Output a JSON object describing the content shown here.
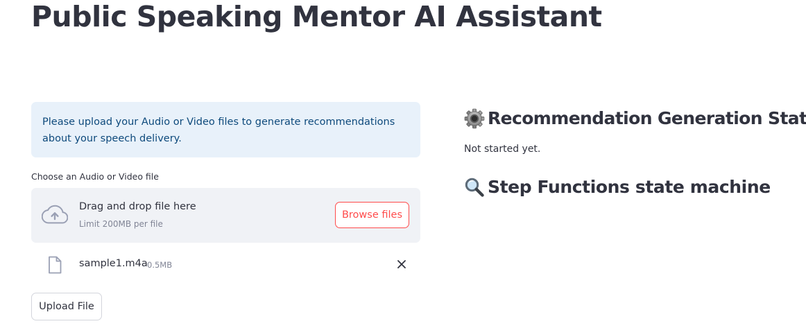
{
  "page": {
    "title": "Public Speaking Mentor AI Assistant"
  },
  "info": {
    "message": "Please upload your Audio or Video files to generate recommendations about your speech delivery."
  },
  "uploader": {
    "label": "Choose an Audio or Video file",
    "drop_text": "Drag and drop file here",
    "limit_text": "Limit 200MB per file",
    "browse_label": "Browse files",
    "upload_icon": "cloud-upload-icon"
  },
  "file": {
    "name": "sample1.m4a",
    "size": "0.5MB",
    "icon": "file-icon"
  },
  "actions": {
    "upload_label": "Upload File"
  },
  "status": {
    "title": "Recommendation Generation Status",
    "icon": "gear-icon",
    "text": "Not started yet."
  },
  "state_machine": {
    "title": "Step Functions state machine",
    "icon": "magnifying-glass-icon"
  },
  "colors": {
    "accent": "#ff4b4b",
    "info_bg": "#e8f1fa",
    "info_text": "#0e4a7c",
    "dropzone_bg": "#f0f2f6",
    "text": "#31333f",
    "muted": "#808495"
  }
}
